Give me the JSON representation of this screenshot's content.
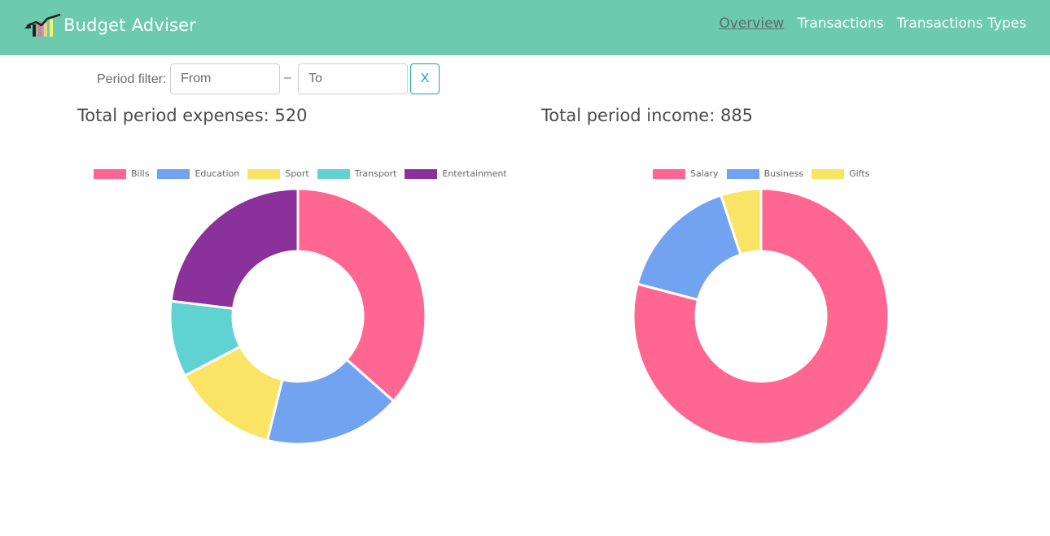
{
  "app": {
    "title": "Budget Adviser"
  },
  "nav": [
    {
      "label": "Overview",
      "active": true
    },
    {
      "label": "Transactions",
      "active": false
    },
    {
      "label": "Transactions Types",
      "active": false
    }
  ],
  "filter": {
    "label": "Period filter:",
    "from_placeholder": "From",
    "to_placeholder": "To",
    "separator": "–",
    "clear_label": "X"
  },
  "expenses": {
    "title": "Total period expenses: 520"
  },
  "income": {
    "title": "Total period income: 885"
  },
  "colors": {
    "navbar": "#6ccbad",
    "pink": "#ff6692",
    "blue": "#72a3f0",
    "yellow": "#fae466",
    "teal": "#5fd2d1",
    "purple": "#8a3299"
  },
  "chart_data": [
    {
      "type": "pie",
      "title": "",
      "categories": [
        "Bills",
        "Education",
        "Sport",
        "Transport",
        "Entertainment"
      ],
      "values": [
        190,
        90,
        70,
        50,
        120
      ],
      "colors": [
        "#ff6692",
        "#72a3f0",
        "#fae466",
        "#5fd2d1",
        "#8a3299"
      ],
      "legend": "top"
    },
    {
      "type": "pie",
      "title": "",
      "categories": [
        "Salary",
        "Business",
        "Gifts"
      ],
      "values": [
        700,
        140,
        45
      ],
      "colors": [
        "#ff6692",
        "#72a3f0",
        "#fae466"
      ],
      "legend": "top"
    }
  ]
}
